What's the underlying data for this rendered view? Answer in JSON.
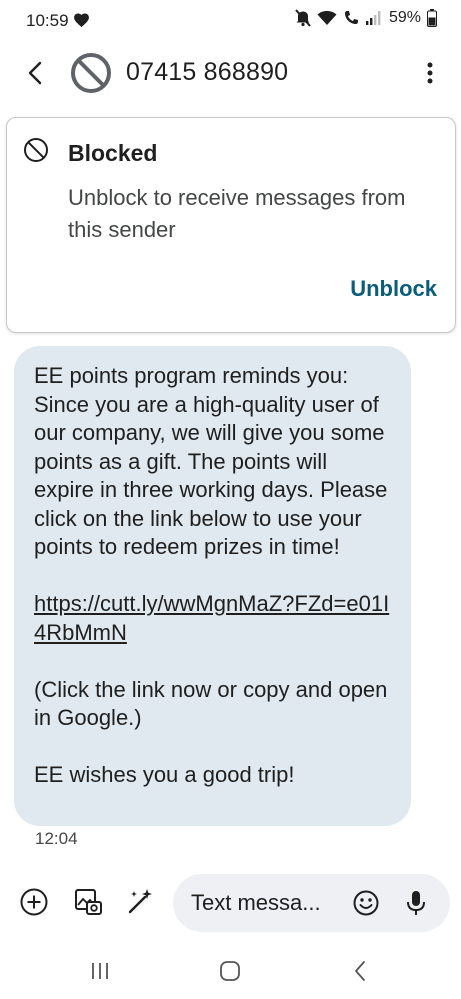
{
  "status_bar": {
    "time": "10:59",
    "battery": "59%",
    "icons": [
      "heart-icon",
      "mute-icon",
      "wifi-icon",
      "wifi-calling-icon",
      "signal-icon",
      "battery-icon"
    ]
  },
  "header": {
    "contact": "07415 868890",
    "icons": [
      "back-arrow-icon",
      "blocked-avatar-icon",
      "more-vert-icon"
    ]
  },
  "blocked_banner": {
    "title": "Blocked",
    "description": "Unblock to receive messages from this sender",
    "action": "Unblock"
  },
  "message": {
    "body": "EE points program reminds you: Since you are a high-quality user of our company, we will give you some points as a gift. The points will expire in three working days. Please click on the link below to use your points to redeem prizes in time!",
    "link": "https://cutt.ly/wwMgnMaZ?FZd=e01I4RbMmN",
    "note": "(Click the link now or copy and open in Google.)",
    "closing": "EE wishes you a good trip!",
    "time": "12:04"
  },
  "compose": {
    "placeholder": "Text messa...",
    "icons": [
      "add-icon",
      "gallery-icon",
      "magic-pen-icon",
      "emoji-icon",
      "mic-icon"
    ]
  },
  "nav": {
    "icons": [
      "recents-icon",
      "home-icon",
      "back-icon"
    ]
  },
  "colors": {
    "bubble": "#e0e9ef",
    "accent": "#0b5d79",
    "compose_field": "#eef0f3"
  }
}
